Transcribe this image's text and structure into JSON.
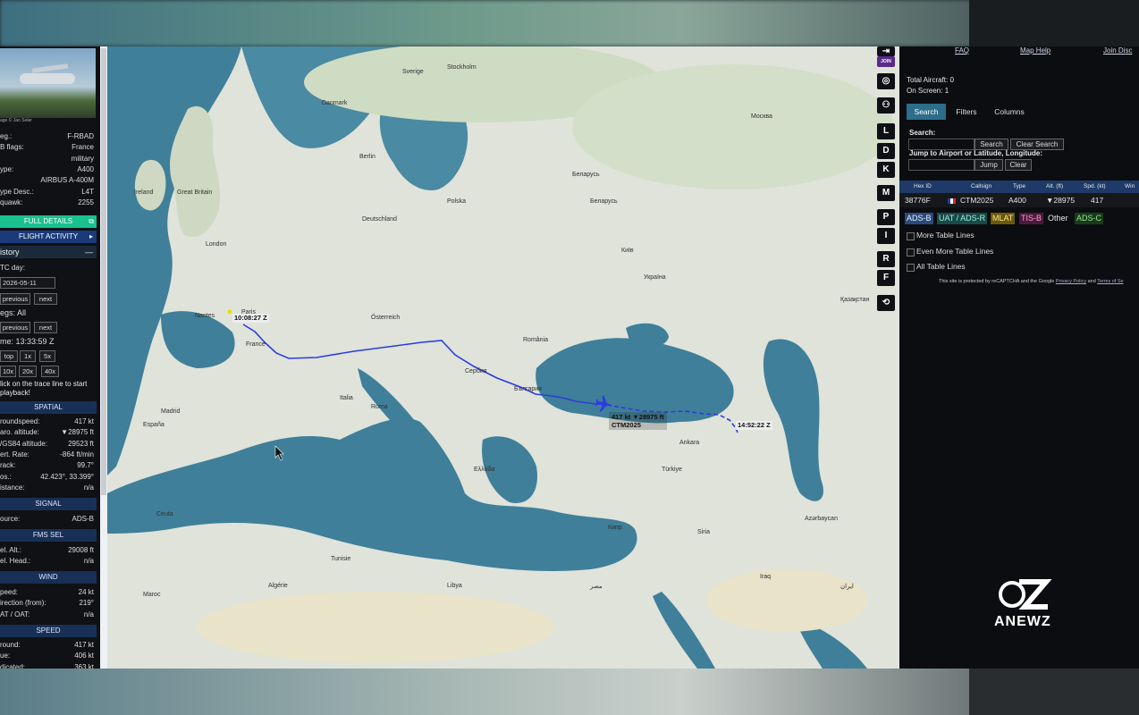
{
  "left_panel": {
    "photo_credit": "age © Jan Seler",
    "info": [
      {
        "k": "eg.:",
        "v": "F-RBAD"
      },
      {
        "k": "B flags:",
        "v": "France"
      },
      {
        "k": "",
        "v": "military"
      },
      {
        "k": "ype:",
        "v": "A400"
      },
      {
        "k": "",
        "v": "AIRBUS A-400M"
      },
      {
        "k": "ype Desc.:",
        "v": "L4T"
      },
      {
        "k": "quawk:",
        "v": "2255"
      }
    ],
    "full_details": "FULL DETAILS",
    "flight_activity": "FLIGHT ACTIVITY",
    "history_title": "istory",
    "utc_day_label": "TC day:",
    "utc_day_value": "2026-05-11",
    "previous": "previous",
    "next": "next",
    "legs_label": "egs: All",
    "time_label": "me: 13:33:59 Z",
    "stop": "top",
    "x1": "1x",
    "x5": "5x",
    "x10": "10x",
    "x20": "20x",
    "x40": "40x",
    "hint": "lick on the trace line to start playback!",
    "spatial_title": "SPATIAL",
    "spatial": [
      {
        "k": "roundspeed:",
        "v": "417 kt"
      },
      {
        "k": "aro. altitude:",
        "v": "▼28975 ft"
      },
      {
        "k": "/GS84 altitude:",
        "v": "29523 ft"
      },
      {
        "k": "ert. Rate:",
        "v": "-864 ft/min"
      },
      {
        "k": "rack:",
        "v": "99.7°"
      },
      {
        "k": "os.:",
        "v": "42.423°, 33.399°"
      },
      {
        "k": "istance:",
        "v": "n/a"
      }
    ],
    "signal_title": "SIGNAL",
    "signal": [
      {
        "k": "ource:",
        "v": "ADS-B"
      }
    ],
    "fms_title": "FMS SEL",
    "fms": [
      {
        "k": "el. Alt.:",
        "v": "29008 ft"
      },
      {
        "k": "el. Head.:",
        "v": "n/a"
      }
    ],
    "wind_title": "WIND",
    "wind": [
      {
        "k": "peed:",
        "v": "24 kt"
      },
      {
        "k": "irection (from):",
        "v": "219°"
      },
      {
        "k": "AT / OAT:",
        "v": "n/a"
      }
    ],
    "speed_title": "SPEED",
    "speed": [
      {
        "k": "round:",
        "v": "417 kt"
      },
      {
        "k": "ue:",
        "v": "406 kt"
      },
      {
        "k": "dicated:",
        "v": "363 kt"
      }
    ]
  },
  "map": {
    "start_time": "10:08:27 Z",
    "end_time": "14:52:22 Z",
    "aircraft_speed_alt": "417 kt  ▼28975 ft",
    "aircraft_callsign": "CTM2025",
    "labels": [
      {
        "t": "Great Britain"
      },
      {
        "t": "London"
      },
      {
        "t": "Paris"
      },
      {
        "t": "France"
      },
      {
        "t": "Nantes"
      },
      {
        "t": "Berlin"
      },
      {
        "t": "Polska"
      },
      {
        "t": "Deutschland"
      },
      {
        "t": "Україна"
      },
      {
        "t": "Київ"
      },
      {
        "t": "Беларусь"
      },
      {
        "t": "Москва"
      },
      {
        "t": "Türkiye"
      },
      {
        "t": "Ankara"
      },
      {
        "t": "Roma"
      },
      {
        "t": "Italia"
      },
      {
        "t": "España"
      },
      {
        "t": "Madrid"
      },
      {
        "t": "Ελλάδα"
      },
      {
        "t": "Algérie"
      },
      {
        "t": "Tunisie"
      },
      {
        "t": "Libya"
      },
      {
        "t": "مصر"
      },
      {
        "t": "Кипр"
      },
      {
        "t": "Azərbaycan"
      },
      {
        "t": "Қазақстан"
      },
      {
        "t": "Беларусь"
      },
      {
        "t": "Stockholm"
      },
      {
        "t": "Sverige"
      },
      {
        "t": "Danmark"
      },
      {
        "t": "România"
      },
      {
        "t": "България"
      },
      {
        "t": "Сербия"
      },
      {
        "t": "Österreich"
      },
      {
        "t": "Ireland"
      },
      {
        "t": "Ceuta"
      },
      {
        "t": "Maroc"
      },
      {
        "t": "Siria"
      },
      {
        "t": "Iraq"
      },
      {
        "t": "ايران"
      }
    ]
  },
  "map_buttons": [
    "⇥",
    "JOIN",
    "◎",
    "⚇",
    "L",
    "D",
    "K",
    "M",
    "P",
    "I",
    "R",
    "F",
    "⟲"
  ],
  "right_panel": {
    "links": [
      "FAQ",
      "Map Help",
      "Join Disc"
    ],
    "total_aircraft": "Total Aircraft: 0",
    "on_screen": "On Screen: 1",
    "tabs": [
      "Search",
      "Filters",
      "Columns"
    ],
    "search_label": "Search:",
    "search_btn": "Search",
    "clear_search_btn": "Clear Search",
    "jump_label": "Jump to Airport or Latitude, Longitude:",
    "jump_btn": "Jump",
    "clear_btn": "Clear",
    "table_headers": [
      "Hex ID",
      "Callsign",
      "Type",
      "Alt. (ft)",
      "Spd. (kt)",
      "Win"
    ],
    "table_row": {
      "hex": "38776F",
      "callsign": "CTM2025",
      "type": "A400",
      "alt": "▼28975",
      "spd": "417"
    },
    "sources": [
      {
        "t": "ADS-B",
        "bg": "#2a4a7a",
        "fg": "#e6f0ff"
      },
      {
        "t": "UAT / ADS-R",
        "bg": "#184a4a",
        "fg": "#9ff0d8"
      },
      {
        "t": "MLAT",
        "bg": "#6a5a10",
        "fg": "#ffe680"
      },
      {
        "t": "TIS-B",
        "bg": "#4a1a3a",
        "fg": "#ff9ad6"
      },
      {
        "t": "Other",
        "bg": "transparent",
        "fg": "#e6e6e6"
      },
      {
        "t": "ADS-C",
        "bg": "#1a3a1a",
        "fg": "#90e890"
      }
    ],
    "options": [
      "More Table Lines",
      "Even More Table Lines",
      "All Table Lines"
    ],
    "captcha_pre": "This site is protected by reCAPTCHA and the Google ",
    "privacy": "Privacy Policy",
    "and": " and ",
    "terms": "Terms of Se"
  },
  "watermark": "ANEWZ",
  "colors": {
    "track": "#2a3de0",
    "accent": "#19c18e",
    "panel": "#0c0d10",
    "sea": "#3f7f99",
    "land": "#dfe3da"
  }
}
